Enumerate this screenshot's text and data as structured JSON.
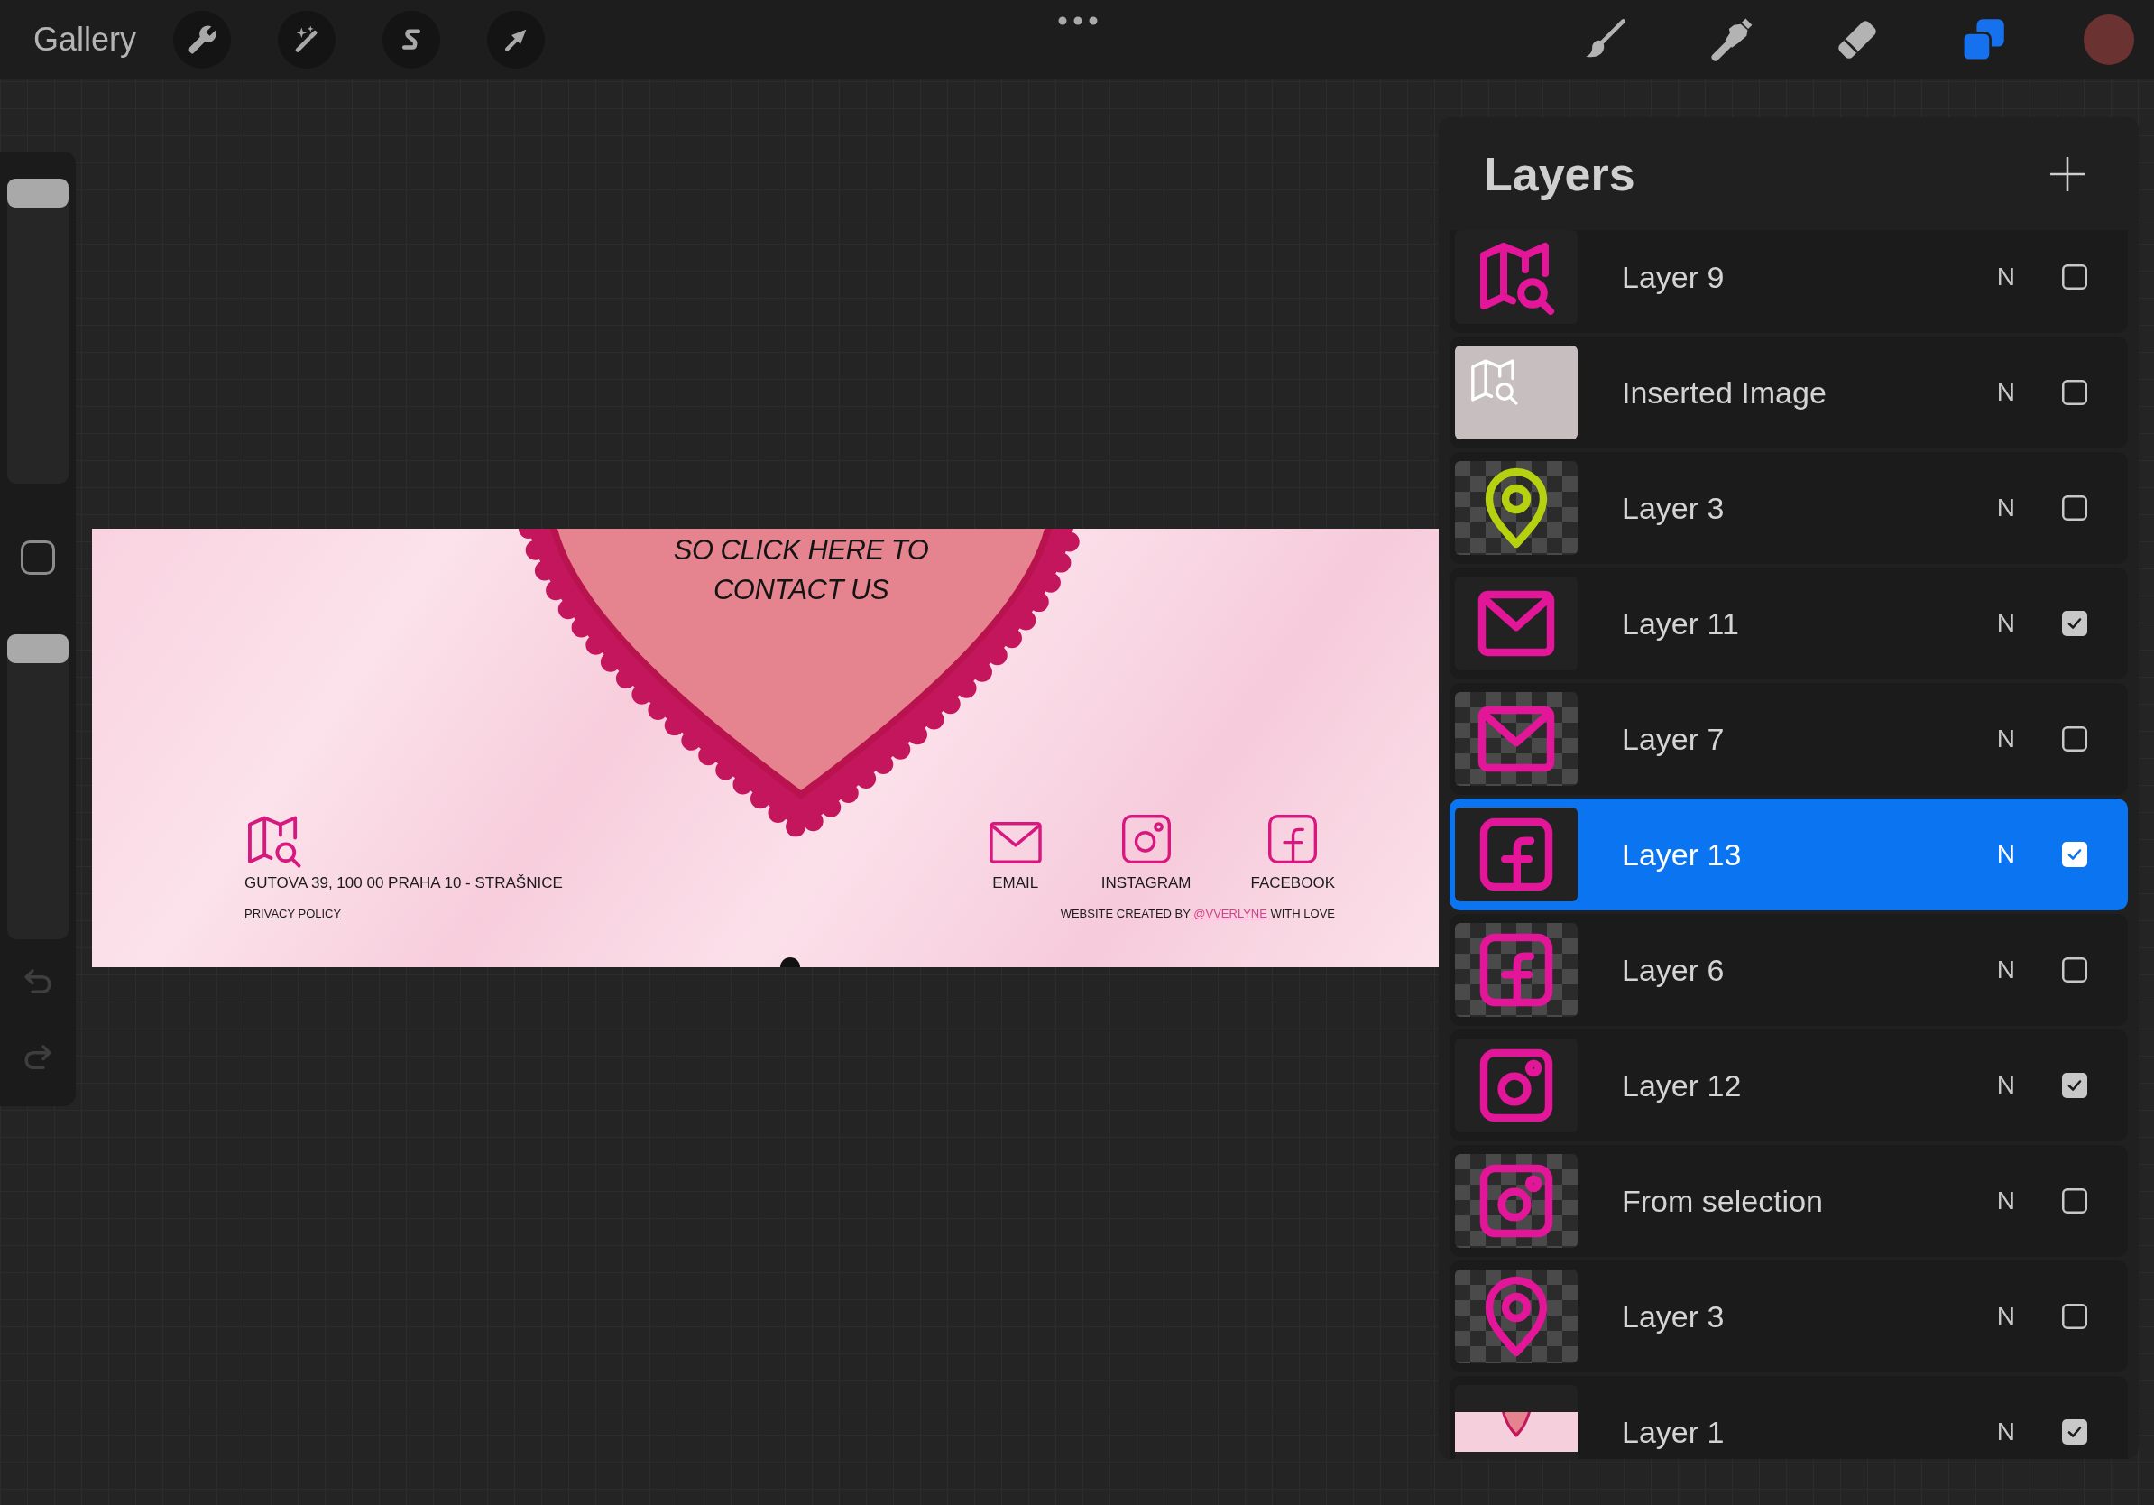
{
  "top_bar": {
    "gallery": "Gallery",
    "tools": [
      {
        "kind": "brush",
        "selected": false
      },
      {
        "kind": "smudge",
        "selected": false
      },
      {
        "kind": "eraser",
        "selected": false
      },
      {
        "kind": "layers",
        "selected": true
      }
    ]
  },
  "side_bar": {
    "brush_size": {
      "level": 1
    },
    "opacity": {
      "level": 1
    },
    "undo": {
      "disabled": true
    },
    "redo": {
      "disabled": true
    }
  },
  "document": {
    "headline": [
      "SO CLICK HERE TO",
      "CONTACT US"
    ],
    "address": "GUTOVA 39, 100 00 PRAHA 10 - STRAŠNICE",
    "privacy_link": "PRIVACY POLICY",
    "contacts": [
      {
        "kind": "email",
        "label": "EMAIL"
      },
      {
        "kind": "instagram",
        "label": "INSTAGRAM"
      },
      {
        "kind": "facebook",
        "label": "FACEBOOK"
      }
    ],
    "credit": {
      "before": "WEBSITE CREATED BY",
      "link": "@VVERLYNE",
      "after": "WITH LOVE"
    }
  },
  "layers_panel": {
    "title": "Layers",
    "layers": [
      {
        "name": "Layer 9",
        "blend": "N",
        "visible": false,
        "selected": false,
        "kind": "map",
        "color": "#e3169a",
        "transparent": false
      },
      {
        "name": "Inserted Image",
        "blend": "N",
        "visible": false,
        "selected": false,
        "kind": "inserted-map",
        "color": "#ffffff",
        "transparent": false
      },
      {
        "name": "Layer 3",
        "blend": "N",
        "visible": false,
        "selected": false,
        "kind": "pin",
        "color": "#b6d10f",
        "transparent": true
      },
      {
        "name": "Layer 11",
        "blend": "N",
        "visible": true,
        "selected": false,
        "kind": "mail",
        "color": "#e3169a",
        "transparent": false
      },
      {
        "name": "Layer 7",
        "blend": "N",
        "visible": false,
        "selected": false,
        "kind": "mail",
        "color": "#e3169a",
        "transparent": true
      },
      {
        "name": "Layer 13",
        "blend": "N",
        "visible": true,
        "selected": true,
        "kind": "facebook",
        "color": "#e3169a",
        "transparent": false
      },
      {
        "name": "Layer 6",
        "blend": "N",
        "visible": false,
        "selected": false,
        "kind": "facebook",
        "color": "#e3169a",
        "transparent": true
      },
      {
        "name": "Layer 12",
        "blend": "N",
        "visible": true,
        "selected": false,
        "kind": "instagram",
        "color": "#e3169a",
        "transparent": false
      },
      {
        "name": "From selection",
        "blend": "N",
        "visible": false,
        "selected": false,
        "kind": "instagram",
        "color": "#e3169a",
        "transparent": true
      },
      {
        "name": "Layer 3",
        "blend": "N",
        "visible": false,
        "selected": false,
        "kind": "pin",
        "color": "#e3169a",
        "transparent": true
      },
      {
        "name": "Layer 1",
        "blend": "N",
        "visible": true,
        "selected": false,
        "kind": "banner",
        "transparent": false
      }
    ]
  }
}
